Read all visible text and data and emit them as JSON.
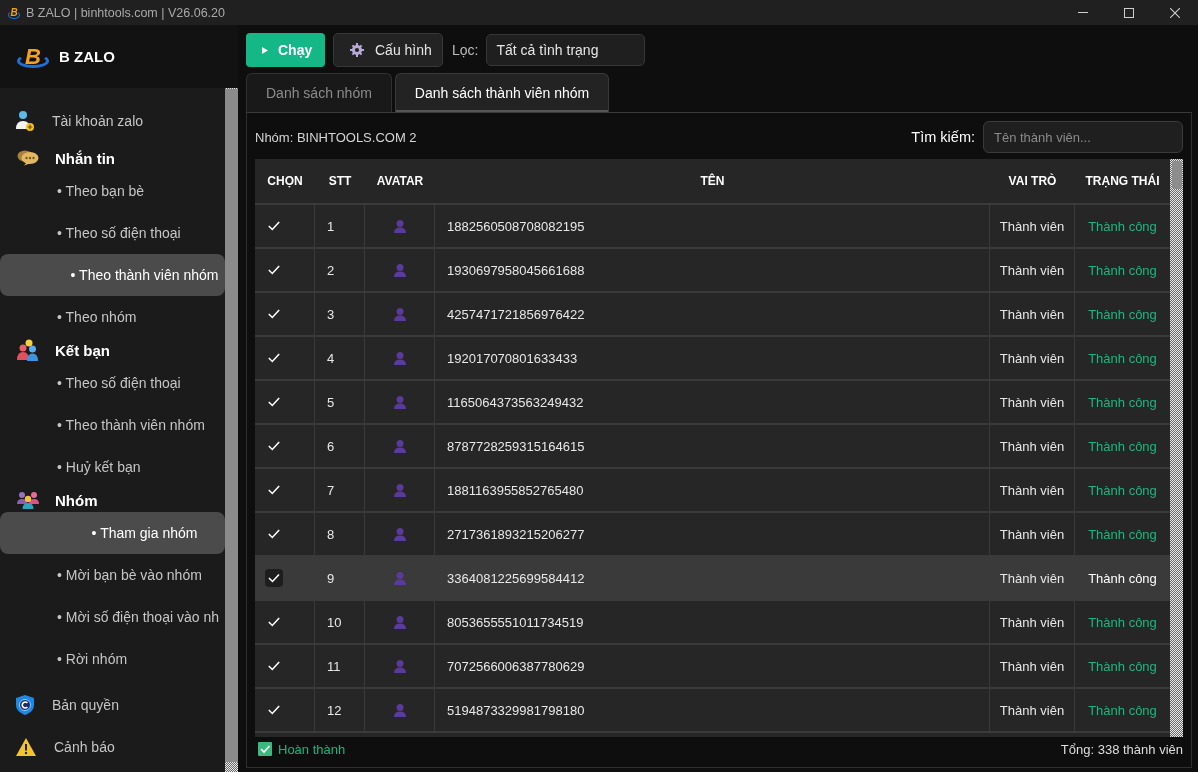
{
  "window": {
    "logo_text": "B",
    "title": "B ZALO | binhtools.com | V26.06.20"
  },
  "sidebar": {
    "logo_text": "B",
    "brand": "B ZALO",
    "items": [
      {
        "kind": "link",
        "label": "Tài khoản zalo",
        "selected": false
      },
      {
        "kind": "section",
        "label": "Nhắn tin",
        "children": [
          {
            "label": "• Theo bạn bè",
            "selected": false
          },
          {
            "label": "• Theo số điện thoại",
            "selected": false
          },
          {
            "label": "• Theo thành viên nhóm",
            "selected": true
          },
          {
            "label": "• Theo nhóm",
            "selected": false
          }
        ]
      },
      {
        "kind": "section",
        "label": "Kết bạn",
        "children": [
          {
            "label": "• Theo số điện thoại",
            "selected": false
          },
          {
            "label": "• Theo thành viên nhóm",
            "selected": false
          },
          {
            "label": "• Huỷ kết bạn",
            "selected": false
          }
        ]
      },
      {
        "kind": "section",
        "label": "Nhóm",
        "children": [
          {
            "label": "• Tham gia nhóm",
            "selected": true
          },
          {
            "label": "• Mời bạn bè vào nhóm",
            "selected": false
          },
          {
            "label": "• Mời số điện thoại vào nh",
            "selected": false
          },
          {
            "label": "• Rời nhóm",
            "selected": false
          }
        ]
      },
      {
        "kind": "link",
        "label": "Bản quyền",
        "selected": false
      },
      {
        "kind": "link",
        "label": "Cảnh báo",
        "selected": false
      }
    ]
  },
  "toolbar": {
    "run_button": "Chạy",
    "config_button": "Cấu hình",
    "filter_label": "Lọc:",
    "filter_value": "Tất cả tình trạng"
  },
  "tabs": [
    {
      "label": "Danh sách nhóm",
      "selected": false
    },
    {
      "label": "Danh sách thành viên nhóm",
      "selected": true
    }
  ],
  "panel": {
    "group_label": "Nhóm: BINHTOOLS.COM 2",
    "search": {
      "label": "Tìm kiếm:",
      "placeholder": "Tên thành viên..."
    }
  },
  "table": {
    "columns": [
      "CHỌN",
      "STT",
      "AVATAR",
      "TÊN",
      "VAI TRÒ",
      "TRẠNG THÁI"
    ],
    "rows": [
      {
        "checked": true,
        "stt": "1",
        "name": "1882560508708082195",
        "role": "Thành viên",
        "status": "Thành công",
        "selected": false
      },
      {
        "checked": true,
        "stt": "2",
        "name": "1930697958045661688",
        "role": "Thành viên",
        "status": "Thành công",
        "selected": false
      },
      {
        "checked": true,
        "stt": "3",
        "name": "4257471721856976422",
        "role": "Thành viên",
        "status": "Thành công",
        "selected": false
      },
      {
        "checked": true,
        "stt": "4",
        "name": "192017070801633433",
        "role": "Thành viên",
        "status": "Thành công",
        "selected": false
      },
      {
        "checked": true,
        "stt": "5",
        "name": "1165064373563249432",
        "role": "Thành viên",
        "status": "Thành công",
        "selected": false
      },
      {
        "checked": true,
        "stt": "6",
        "name": "8787728259315164615",
        "role": "Thành viên",
        "status": "Thành công",
        "selected": false
      },
      {
        "checked": true,
        "stt": "7",
        "name": "1881163955852765480",
        "role": "Thành viên",
        "status": "Thành công",
        "selected": false
      },
      {
        "checked": true,
        "stt": "8",
        "name": "2717361893215206277",
        "role": "Thành viên",
        "status": "Thành công",
        "selected": false
      },
      {
        "checked": true,
        "stt": "9",
        "name": "3364081225699584412",
        "role": "Thành viên",
        "status": "Thành công",
        "selected": true
      },
      {
        "checked": true,
        "stt": "10",
        "name": "8053655551011734519",
        "role": "Thành viên",
        "status": "Thành công",
        "selected": false
      },
      {
        "checked": true,
        "stt": "11",
        "name": "7072566006387780629",
        "role": "Thành viên",
        "status": "Thành công",
        "selected": false
      },
      {
        "checked": true,
        "stt": "12",
        "name": "5194873329981798180",
        "role": "Thành viên",
        "status": "Thành công",
        "selected": false
      }
    ]
  },
  "status_bar": {
    "status": "Hoàn thành",
    "total": "Tổng: 338 thành viên"
  }
}
